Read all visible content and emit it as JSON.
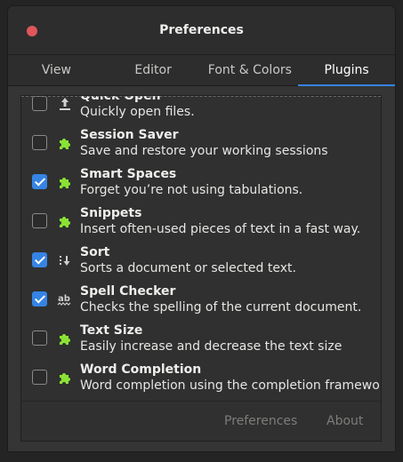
{
  "window": {
    "title": "Preferences"
  },
  "tabs": [
    {
      "label": "View",
      "active": false
    },
    {
      "label": "Editor",
      "active": false
    },
    {
      "label": "Font & Colors",
      "active": false
    },
    {
      "label": "Plugins",
      "active": true
    }
  ],
  "plugins": [
    {
      "name": "Quick Open",
      "description": "Quickly open files.",
      "checked": false,
      "icon": "arrow-up-icon"
    },
    {
      "name": "Session Saver",
      "description": "Save and restore your working sessions",
      "checked": false,
      "icon": "puzzle-icon"
    },
    {
      "name": "Smart Spaces",
      "description": "Forget you’re not using tabulations.",
      "checked": true,
      "icon": "puzzle-icon"
    },
    {
      "name": "Snippets",
      "description": "Insert often-used pieces of text in a fast way.",
      "checked": false,
      "icon": "puzzle-icon"
    },
    {
      "name": "Sort",
      "description": "Sorts a document or selected text.",
      "checked": true,
      "icon": "sort-icon"
    },
    {
      "name": "Spell Checker",
      "description": "Checks the spelling of the current document.",
      "checked": true,
      "icon": "spellcheck-icon"
    },
    {
      "name": "Text Size",
      "description": "Easily increase and decrease the text size",
      "checked": false,
      "icon": "puzzle-icon"
    },
    {
      "name": "Word Completion",
      "description": "Word completion using the completion framework",
      "checked": false,
      "icon": "puzzle-icon"
    }
  ],
  "footer": {
    "preferences_label": "Preferences",
    "about_label": "About"
  },
  "colors": {
    "accent": "#3584e4",
    "puzzle_green": "#8ae234",
    "close": "#e0565b"
  }
}
